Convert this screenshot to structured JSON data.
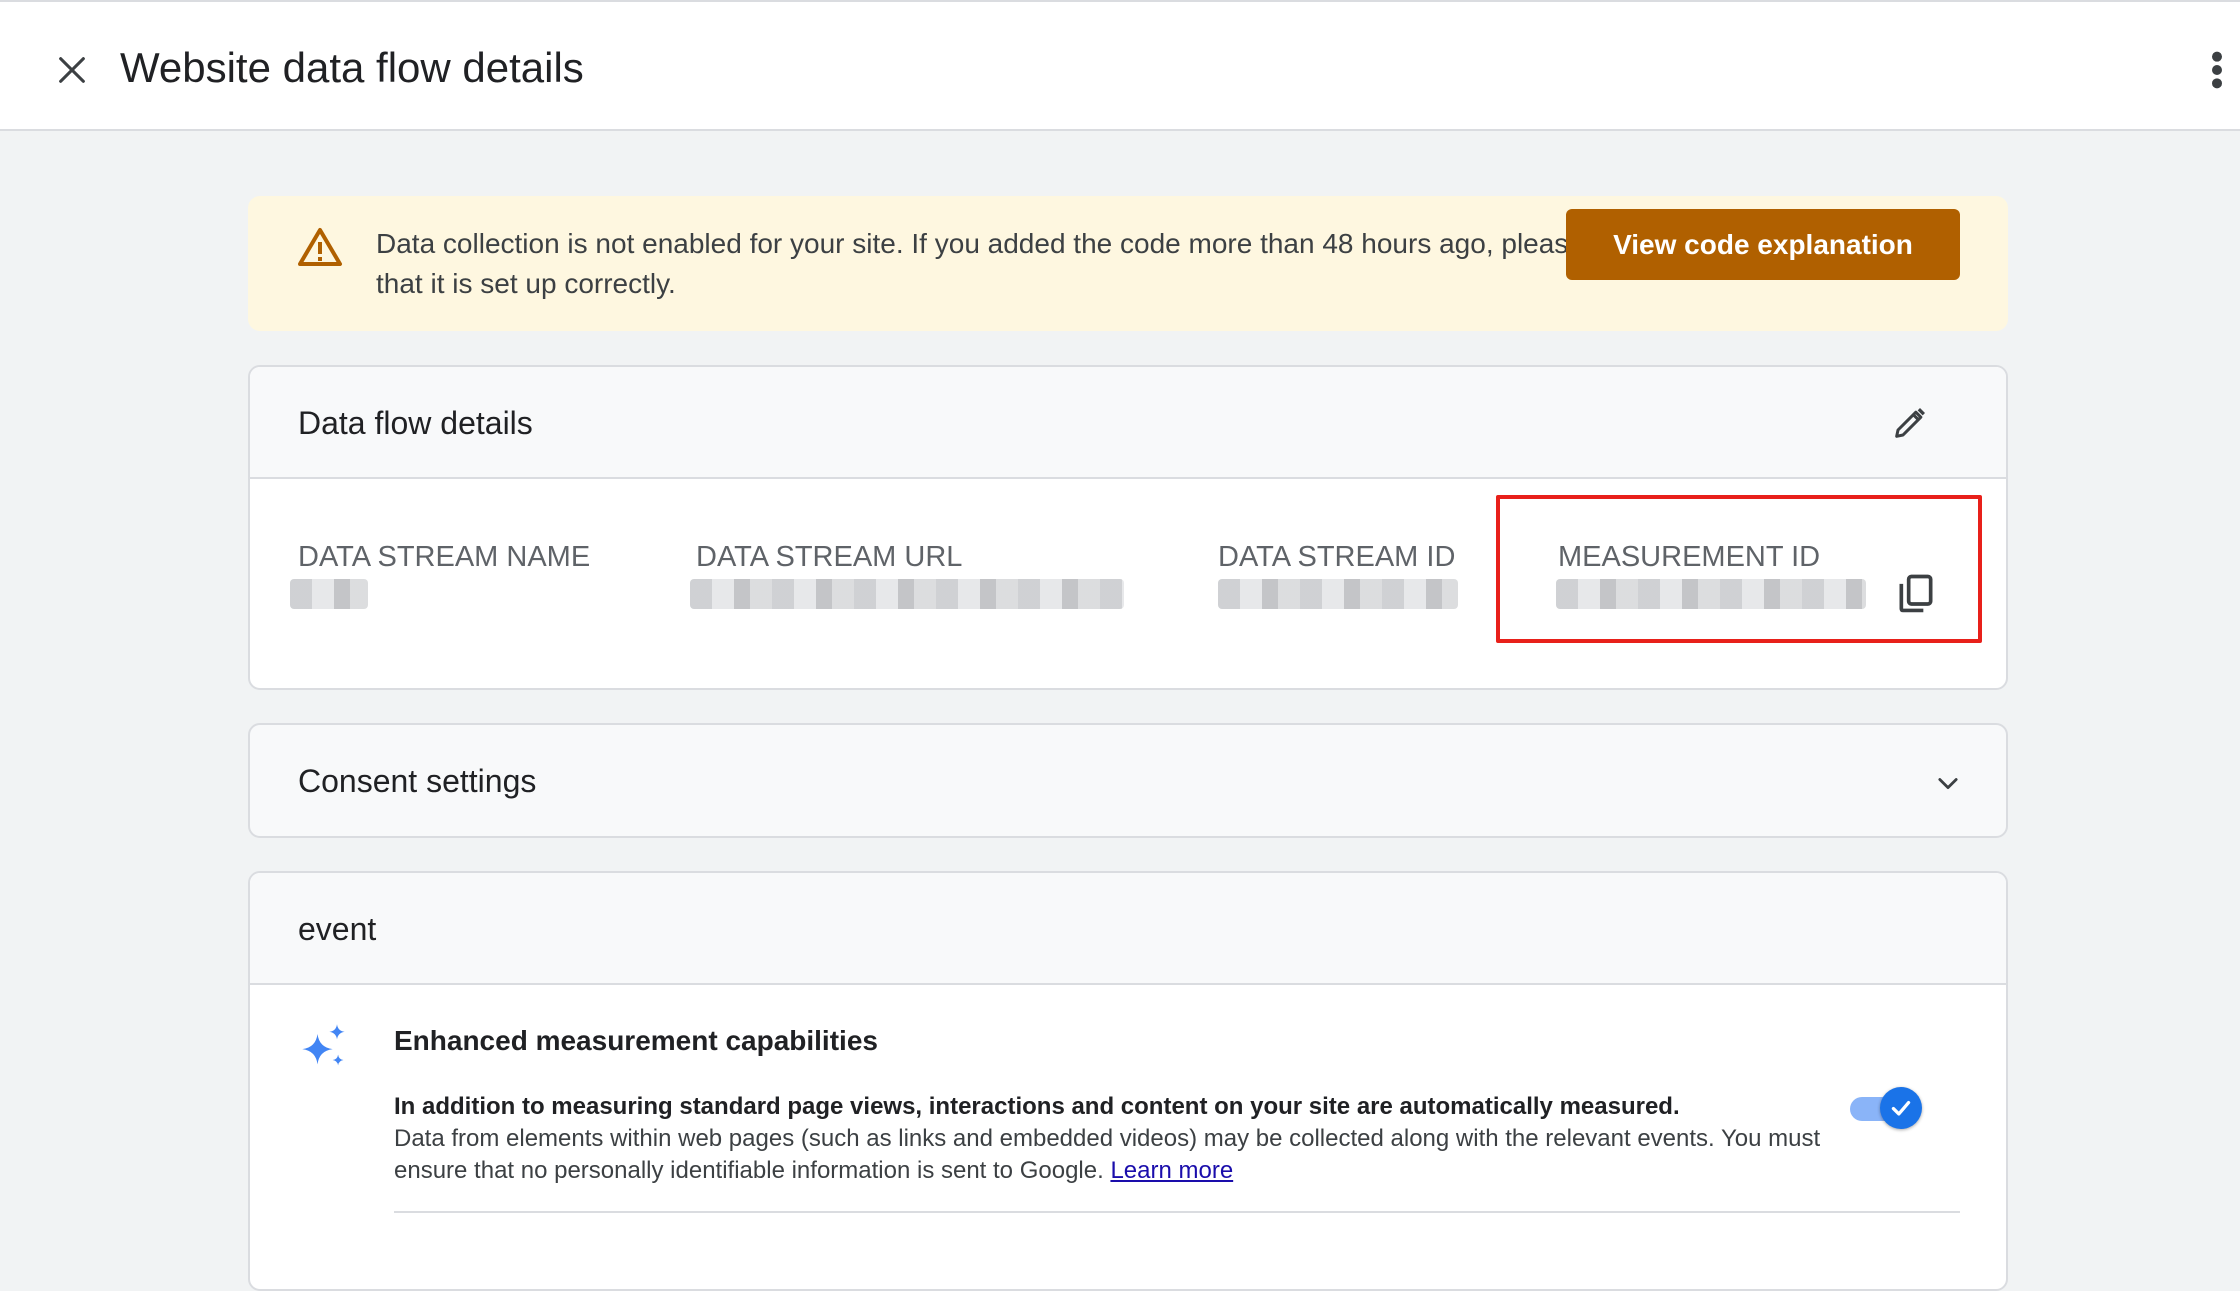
{
  "header": {
    "title": "Website data flow details",
    "close_icon": "close-icon",
    "more_icon": "more-vert-icon"
  },
  "banner": {
    "icon": "warning-icon",
    "message": "Data collection is not enabled for your site. If you added the code more than 48 hours ago, please make sure that it is set up correctly.",
    "button_label": "View code explanation",
    "colors": {
      "background": "#fef7e0",
      "button": "#b06000",
      "icon": "#b06000"
    }
  },
  "details_card": {
    "title": "Data flow details",
    "edit_icon": "edit-pencil-icon",
    "fields": [
      {
        "label": "DATA STREAM NAME",
        "value_redacted": true
      },
      {
        "label": "DATA STREAM URL",
        "value_redacted": true
      },
      {
        "label": "DATA STREAM ID",
        "value_redacted": true
      },
      {
        "label": "MEASUREMENT ID",
        "value_redacted": true,
        "copy_icon": "copy-icon",
        "highlighted": true
      }
    ],
    "highlight_color": "#e8201a"
  },
  "consent_card": {
    "title": "Consent settings",
    "chevron_icon": "chevron-down-icon"
  },
  "event_card": {
    "title": "event",
    "enhanced_measurement": {
      "icon": "sparkle-icon",
      "title": "Enhanced measurement capabilities",
      "description_bold": "In addition to measuring standard page views, interactions and content on your site are automatically measured.",
      "description": "Data from elements within web pages (such as links and embedded videos) may be collected along with the relevant events. You must ensure that no personally identifiable information is sent to Google.",
      "learn_more": "Learn more",
      "toggle_on": true,
      "toggle_color": "#1a73e8"
    }
  }
}
